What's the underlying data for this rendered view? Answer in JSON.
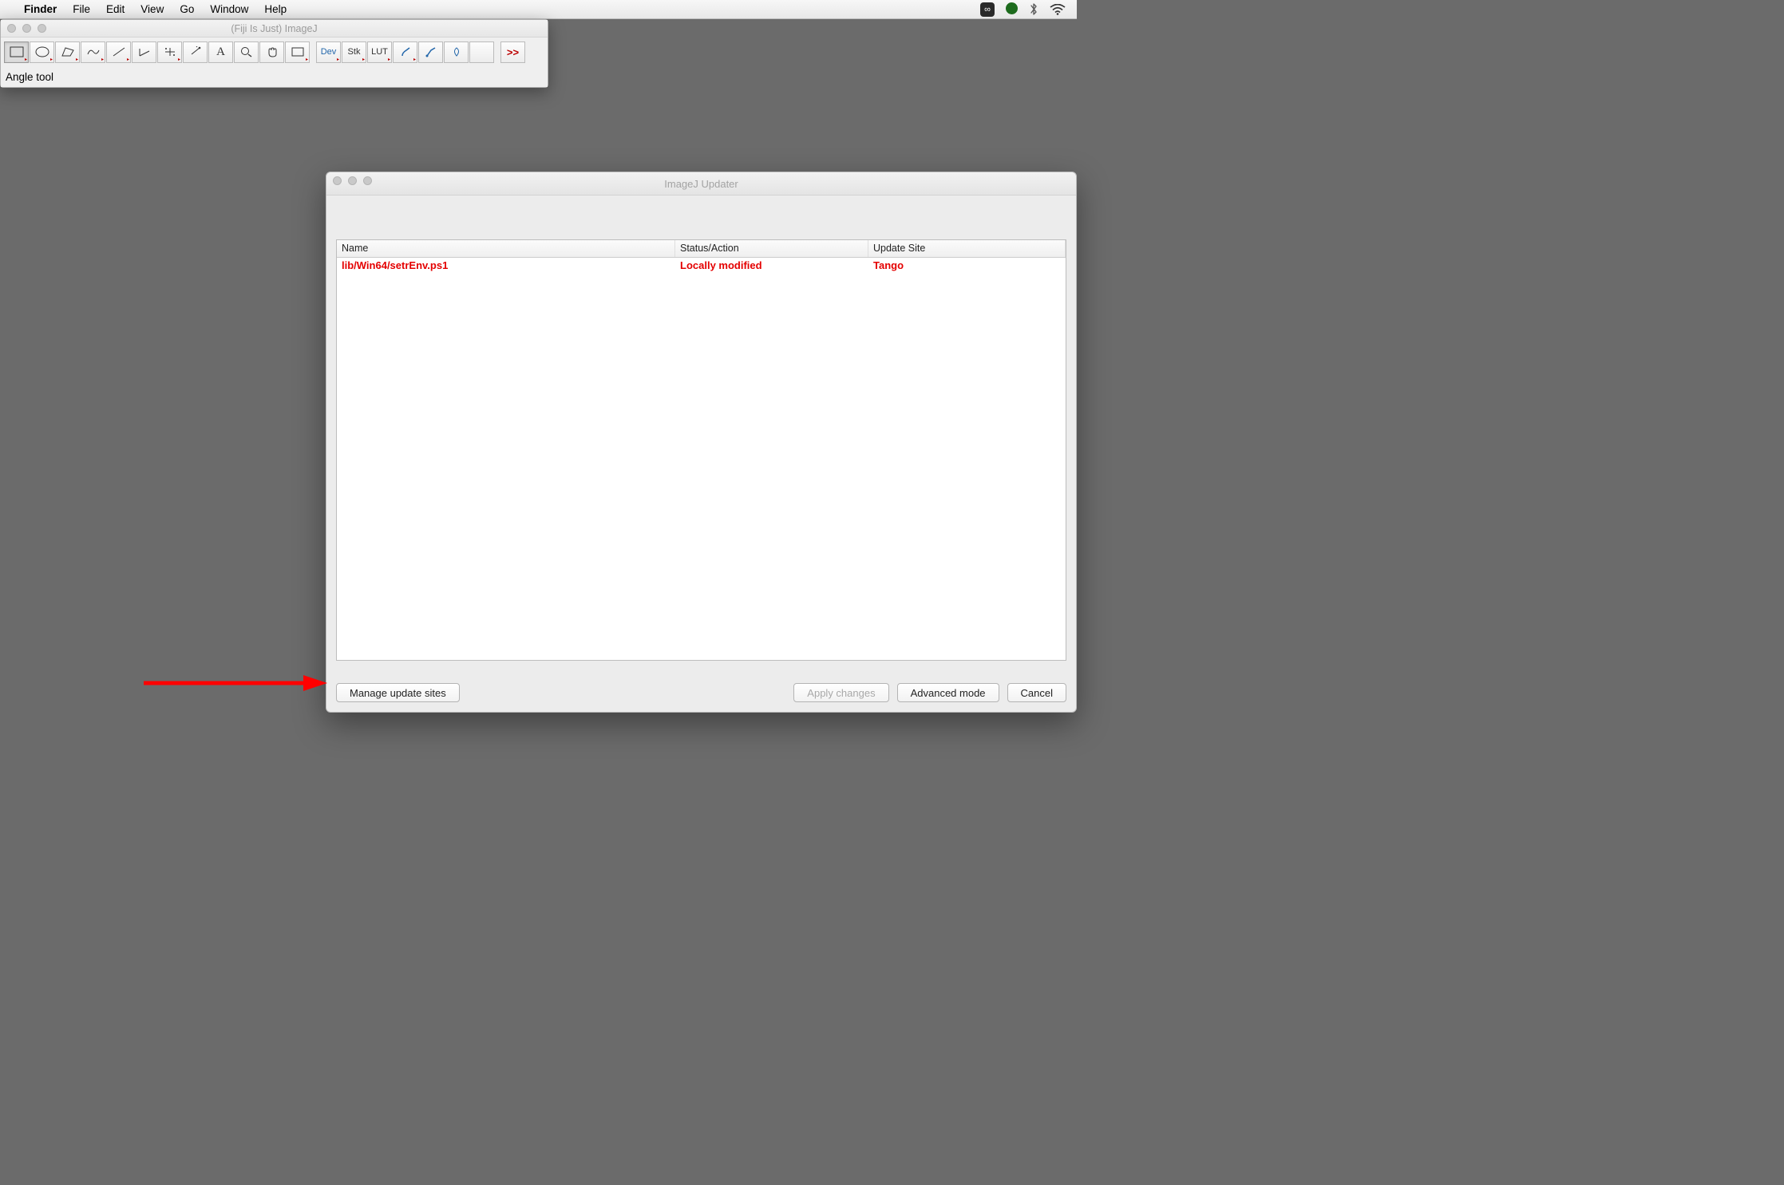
{
  "menubar": {
    "active_app": "Finder",
    "items": [
      "File",
      "Edit",
      "View",
      "Go",
      "Window",
      "Help"
    ]
  },
  "imagej": {
    "window_title": "(Fiji Is Just) ImageJ",
    "tools": [
      "Dev",
      "Stk",
      "LUT"
    ],
    "status": "Angle tool",
    "more": ">>"
  },
  "updater": {
    "title": "ImageJ Updater",
    "columns": {
      "name": "Name",
      "status": "Status/Action",
      "site": "Update Site"
    },
    "rows": [
      {
        "name": "lib/Win64/setrEnv.ps1",
        "status": "Locally modified",
        "site": "Tango"
      }
    ],
    "buttons": {
      "manage": "Manage update sites",
      "apply": "Apply changes",
      "advanced": "Advanced mode",
      "cancel": "Cancel"
    }
  }
}
